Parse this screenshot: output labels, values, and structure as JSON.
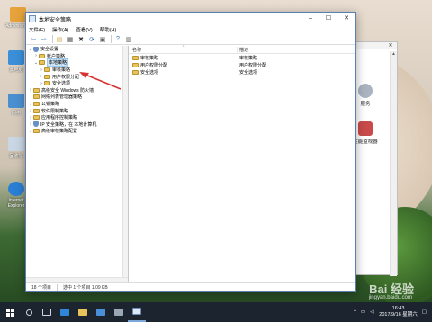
{
  "desktop": {
    "icons": [
      {
        "label": "Administra...",
        "color": "#e6a33b"
      },
      {
        "label": "此电脑",
        "color": "#3a8fd8"
      },
      {
        "label": "网络",
        "color": "#4a8fd0"
      },
      {
        "label": "回收站",
        "color": "#c9d6e4"
      },
      {
        "label": "Internet Explorer",
        "color": "#2a7fd4"
      }
    ]
  },
  "background_window": {
    "items": [
      {
        "label": "服务",
        "color": "#a9b4c0"
      },
      {
        "label": "性能监视器",
        "color": "#c94a4a"
      }
    ]
  },
  "window": {
    "title": "本地安全策略",
    "menu": [
      "文件(F)",
      "操作(A)",
      "查看(V)",
      "帮助(H)"
    ],
    "toolbar_icons": [
      "back-arrow-icon",
      "forward-arrow-icon",
      "up-folder-icon",
      "properties-icon",
      "delete-icon",
      "refresh-icon",
      "export-icon",
      "help-icon",
      "console-icon"
    ],
    "tree": [
      {
        "label": "安全设置",
        "level": 0,
        "expander": "v",
        "icon": "shield",
        "selected": false
      },
      {
        "label": "帐户策略",
        "level": 1,
        "expander": ">",
        "icon": "folder",
        "selected": false
      },
      {
        "label": "本地策略",
        "level": 1,
        "expander": "v",
        "icon": "folder",
        "selected": true
      },
      {
        "label": "审核策略",
        "level": 2,
        "expander": ">",
        "icon": "folder",
        "selected": false
      },
      {
        "label": "用户权限分配",
        "level": 2,
        "expander": ">",
        "icon": "folder",
        "selected": false
      },
      {
        "label": "安全选项",
        "level": 2,
        "expander": ">",
        "icon": "folder",
        "selected": false
      },
      {
        "label": "高级安全 Windows 防火墙",
        "level": 1,
        "expander": ">",
        "icon": "folder",
        "selected": false
      },
      {
        "label": "网络列表管理器策略",
        "level": 1,
        "expander": "",
        "icon": "folder",
        "selected": false
      },
      {
        "label": "公钥策略",
        "level": 1,
        "expander": ">",
        "icon": "folder",
        "selected": false
      },
      {
        "label": "软件限制策略",
        "level": 1,
        "expander": ">",
        "icon": "folder",
        "selected": false
      },
      {
        "label": "应用程序控制策略",
        "level": 1,
        "expander": ">",
        "icon": "folder",
        "selected": false
      },
      {
        "label": "IP 安全策略，在 本地计算机",
        "level": 1,
        "expander": ">",
        "icon": "shield",
        "selected": false
      },
      {
        "label": "高级审核策略配置",
        "level": 1,
        "expander": ">",
        "icon": "folder",
        "selected": false
      }
    ],
    "list": {
      "col_name": "名称",
      "col_desc": "描述",
      "rows": [
        {
          "name": "审核策略",
          "desc": "审核策略"
        },
        {
          "name": "用户权限分配",
          "desc": "用户权限分配"
        },
        {
          "name": "安全选项",
          "desc": "安全选项"
        }
      ]
    },
    "status": {
      "items_count": "18 个项目",
      "selected": "选中 1 个项目  1.09 KB"
    }
  },
  "taskbar": {
    "time": "16:43",
    "date": "2017/9/16 星期六"
  },
  "watermark": {
    "brand": "Bai 经验",
    "url": "jingyan.baidu.com"
  }
}
